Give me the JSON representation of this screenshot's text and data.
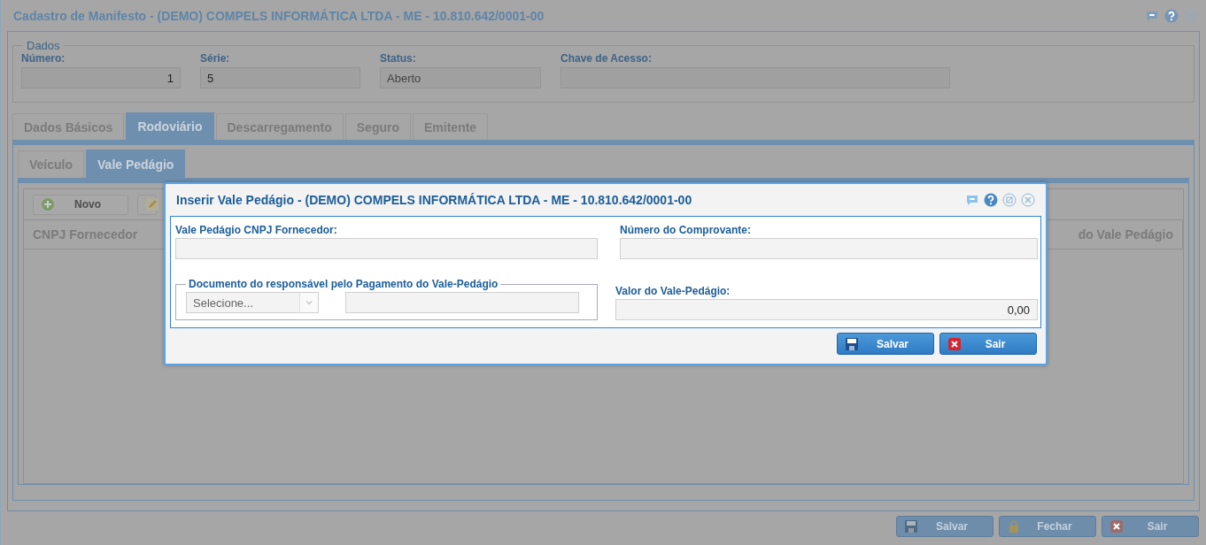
{
  "window": {
    "title": "Cadastro de Manifesto - (DEMO) COMPELS INFORMÁTICA LTDA - ME - 10.810.642/0001-00"
  },
  "dados": {
    "legend": "Dados",
    "fields": [
      {
        "label": "Número:",
        "value": "1",
        "kind": "numeric"
      },
      {
        "label": "Série:",
        "value": "5",
        "kind": "text"
      },
      {
        "label": "Status:",
        "value": "Aberto",
        "kind": "readonly"
      },
      {
        "label": "Chave de Acesso:",
        "kind": "text"
      }
    ]
  },
  "tabs": [
    {
      "label": "Dados Básicos",
      "selected": false
    },
    {
      "label": "Rodoviário",
      "selected": true
    },
    {
      "label": "Descarregamento",
      "selected": false
    },
    {
      "label": "Seguro",
      "selected": false
    },
    {
      "label": "Emitente",
      "selected": false
    }
  ],
  "subtabs": [
    {
      "label": "Veículo",
      "selected": false
    },
    {
      "label": "Vale Pedágio",
      "selected": true
    }
  ],
  "toolbar": [
    {
      "kind": "add",
      "label": "Novo"
    },
    {
      "kind": "edit"
    }
  ],
  "table": {
    "columns": [
      {
        "label": "CNPJ Fornecedor"
      },
      {
        "label": "do Vale Pedágio"
      }
    ]
  },
  "dialog": {
    "title": "Inserir Vale Pedágio - (DEMO) COMPELS INFORMÁTICA LTDA - ME - 10.810.642/0001-00",
    "cnpj": {
      "label": "Vale Pedágio CNPJ Fornecedor:"
    },
    "comprovante": {
      "label": "Número do Comprovante:"
    },
    "responsavel": {
      "legend": "Documento do responsável pelo Pagamento do Vale-Pedágio",
      "select": "Selecione..."
    },
    "valor": {
      "label": "Valor do Vale-Pedágio:",
      "value": "0,00"
    },
    "buttons": [
      {
        "kind": "save",
        "label": "Salvar"
      },
      {
        "kind": "exit",
        "label": "Sair"
      }
    ]
  },
  "footer": [
    {
      "kind": "save",
      "label": "Salvar"
    },
    {
      "kind": "lock",
      "label": "Fechar"
    },
    {
      "kind": "exit",
      "label": "Sair"
    }
  ]
}
